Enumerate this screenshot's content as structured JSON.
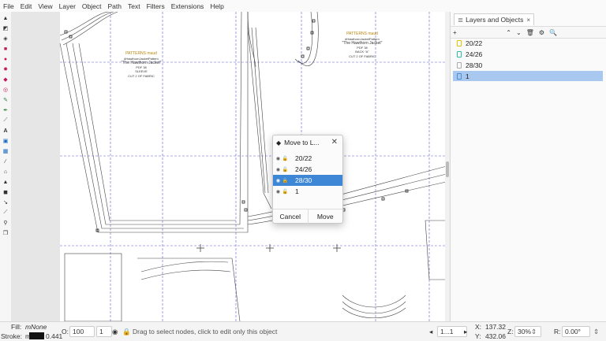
{
  "menubar": [
    "File",
    "Edit",
    "View",
    "Layer",
    "Object",
    "Path",
    "Text",
    "Filters",
    "Extensions",
    "Help"
  ],
  "tools": [
    "pointer-icon",
    "node-icon",
    "tweak-icon",
    "rect-icon",
    "circle-icon",
    "star-icon",
    "box3d-icon",
    "spiral-icon",
    "pencil-icon",
    "pen-icon",
    "calligraphy-icon",
    "text-icon",
    "gradient-icon",
    "mesh-icon",
    "dropper-icon",
    "paint-bucket-icon",
    "spray-icon",
    "eraser-icon",
    "connector-icon",
    "measure-icon",
    "zoom-icon",
    "pages-icon"
  ],
  "panel": {
    "tab_label": "Layers and Objects",
    "tab_close": "×",
    "toolbar": [
      "+",
      "⌃",
      "⌄",
      "🗑",
      "⚙",
      "🔍"
    ],
    "layers": [
      {
        "name": "20/22",
        "color": "#e6c200",
        "selected": false
      },
      {
        "name": "24/26",
        "color": "#2bbfa0",
        "selected": false
      },
      {
        "name": "28/30",
        "color": "#aaaaaa",
        "selected": false
      },
      {
        "name": "1",
        "color": "#4a90d9",
        "selected": true
      }
    ]
  },
  "dialog": {
    "title": "Move to L...",
    "close": "✕",
    "layers": [
      "20/22",
      "24/26",
      "28/30",
      "1"
    ],
    "selected_index": 2,
    "cancel_label": "Cancel",
    "move_label": "Move"
  },
  "canvas": {
    "pattern_logo_1": "PATTERNS maud",
    "hashtag_1": "#HawthornJacketPattern",
    "jacket_title_1": "\"The Hawthorn Jacket\"",
    "pdf_1": "PDF 38",
    "piece_1": "SLEEVE",
    "cut_1": "CUT 2 OF FABRIC",
    "pattern_logo_2": "PATTERNS maud",
    "hashtag_2": "#HawthornJacketPattern",
    "jacket_title_2": "\"The Hawthorn Jacket\"",
    "pdf_2": "PDF 38",
    "piece_2": "BACK \"A\"",
    "cut_2": "CUT 2 OF FABRIC"
  },
  "status": {
    "fill_label": "Fill:",
    "fill_value": "m",
    "fill_none": "None",
    "stroke_label": "Stroke:",
    "stroke_value": "m",
    "stroke_width": "0.441",
    "opacity_label": "O:",
    "opacity_value": "100",
    "layer_value": "1",
    "message": "Drag to select nodes, click to edit only this object",
    "page_nav": "1...1",
    "x_label": "X:",
    "x_value": "137.32",
    "y_label": "Y:",
    "y_value": "432.06",
    "zoom_label": "Z:",
    "zoom_value": "30%",
    "rot_label": "R:",
    "rot_value": "0.00°"
  }
}
